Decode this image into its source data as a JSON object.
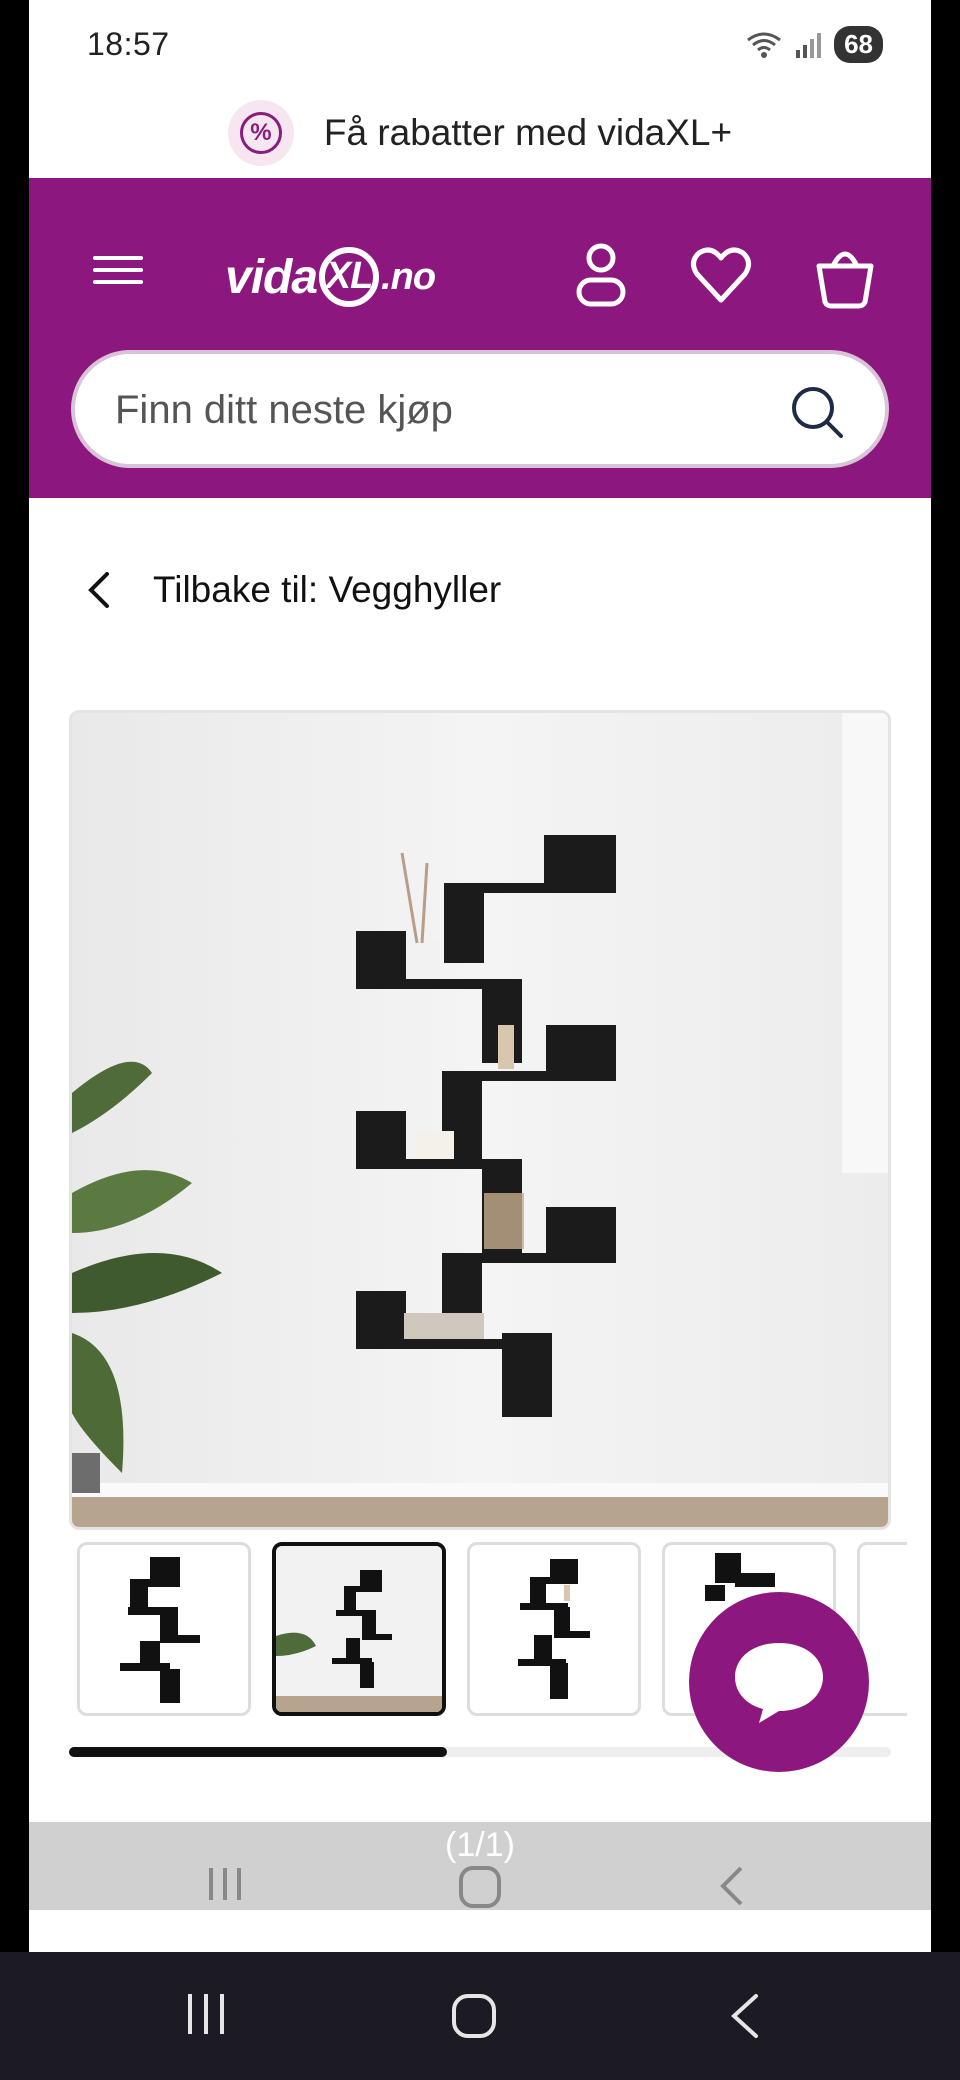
{
  "status_bar": {
    "time": "18:57",
    "battery": "68"
  },
  "promo": {
    "text": "Få rabatter med vidaXL+",
    "icon": "percent-icon"
  },
  "header": {
    "logo_text_a": "vida",
    "logo_text_xl": "XL",
    "logo_text_no": ".no",
    "search_placeholder": "Finn ditt neste kjøp",
    "icons": [
      "menu-icon",
      "user-icon",
      "heart-icon",
      "basket-icon",
      "search-icon"
    ]
  },
  "breadcrumb": {
    "back_label": "Tilbake til: Vegghyller"
  },
  "gallery": {
    "thumbnail_count_visible": 5,
    "active_index": 1,
    "scroll_progress": 0.46
  },
  "overlay": {
    "counter": "(1/1)"
  },
  "colors": {
    "brand": "#8c177f",
    "text": "#222222"
  }
}
